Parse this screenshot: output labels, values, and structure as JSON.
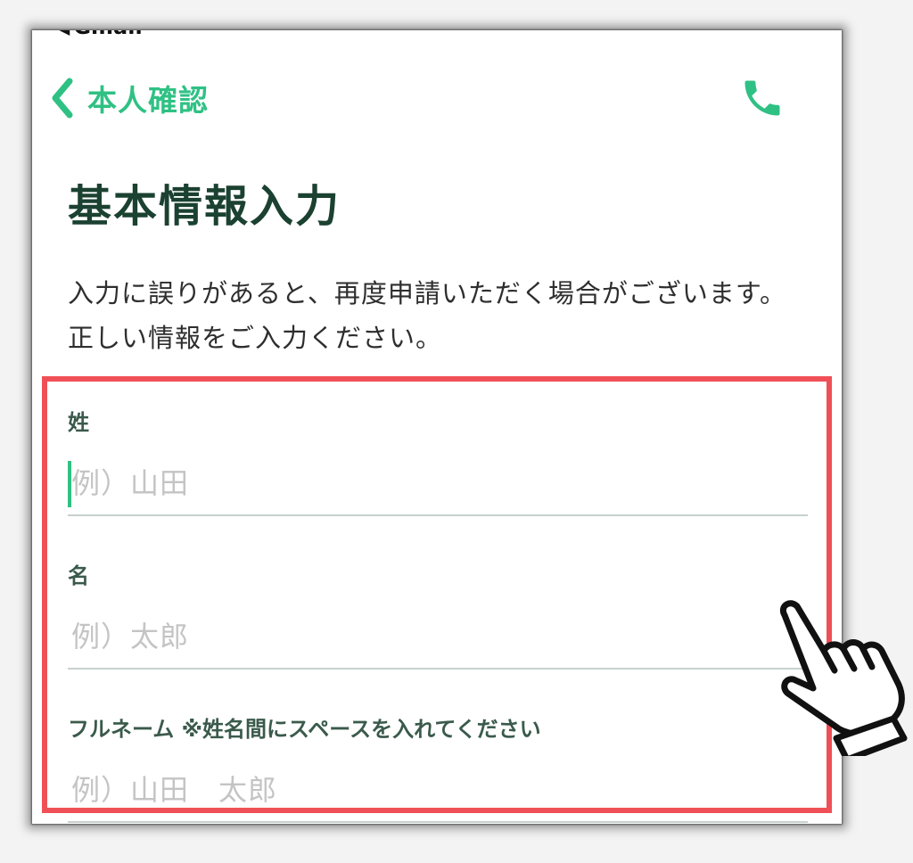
{
  "status_bar": {
    "back_app": "Gmail"
  },
  "nav": {
    "back_label": "本人確認",
    "call_icon": "phone-icon"
  },
  "page": {
    "title": "基本情報入力",
    "notice": "入力に誤りがあると、再度申請いただく場合がございます。正しい情報をご入力ください。"
  },
  "form": {
    "last_name": {
      "label": "姓",
      "placeholder": "例）山田",
      "value": ""
    },
    "first_name": {
      "label": "名",
      "placeholder": "例）太郎",
      "value": ""
    },
    "full_name": {
      "label": "フルネーム ※姓名間にスペースを入れてください",
      "placeholder": "例）山田　太郎",
      "value": ""
    }
  },
  "colors": {
    "accent": "#2fc184",
    "title": "#1b4131",
    "highlight": "#ef5057"
  },
  "annotation": {
    "icon": "pointing-hand-icon"
  }
}
